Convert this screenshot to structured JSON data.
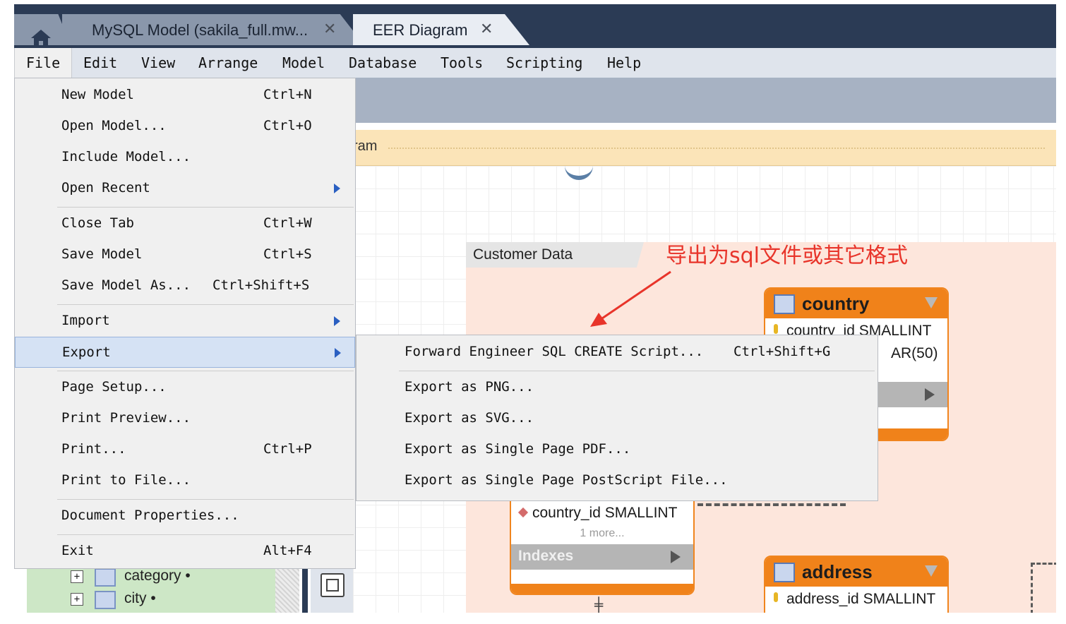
{
  "tabs": [
    {
      "label": "MySQL Model (sakila_full.mw...",
      "close": "✕"
    },
    {
      "label": "EER Diagram",
      "close": "✕"
    }
  ],
  "menubar": [
    "File",
    "Edit",
    "View",
    "Arrange",
    "Model",
    "Database",
    "Tools",
    "Scripting",
    "Help"
  ],
  "infobar": {
    "text": "ram"
  },
  "layer": {
    "label": "Customer Data"
  },
  "annotation": {
    "text": "导出为sql文件或其它格式",
    "color": "#e8342a"
  },
  "tables": {
    "country": {
      "title": "country",
      "col1": "country_id SMALLINT",
      "col2": "AR(50)"
    },
    "city_fk": {
      "col": "country_id SMALLINT",
      "more": "1 more...",
      "indexes": "Indexes"
    },
    "address": {
      "title": "address",
      "col1": "address_id SMALLINT"
    }
  },
  "tree": [
    {
      "label": "category •"
    },
    {
      "label": "city •"
    }
  ],
  "file_menu": [
    {
      "label": "New Model",
      "shortcut": "Ctrl+N"
    },
    {
      "label": "Open Model...",
      "shortcut": "Ctrl+O"
    },
    {
      "label": "Include Model...",
      "shortcut": ""
    },
    {
      "label": "Open Recent",
      "shortcut": "",
      "submenu": true
    },
    {
      "label": "Close Tab",
      "shortcut": "Ctrl+W"
    },
    {
      "label": "Save Model",
      "shortcut": "Ctrl+S"
    },
    {
      "label": "Save Model As...",
      "shortcut": "Ctrl+Shift+S"
    },
    {
      "label": "Import",
      "shortcut": "",
      "submenu": true
    },
    {
      "label": "Export",
      "shortcut": "",
      "submenu": true,
      "highlighted": true
    },
    {
      "label": "Page Setup...",
      "shortcut": ""
    },
    {
      "label": "Print Preview...",
      "shortcut": ""
    },
    {
      "label": "Print...",
      "shortcut": "Ctrl+P"
    },
    {
      "label": "Print to File...",
      "shortcut": ""
    },
    {
      "label": "Document Properties...",
      "shortcut": ""
    },
    {
      "label": "Exit",
      "shortcut": "Alt+F4"
    }
  ],
  "export_submenu": [
    {
      "label": "Forward Engineer SQL CREATE Script...",
      "shortcut": "Ctrl+Shift+G"
    },
    {
      "label": "Export as PNG...",
      "shortcut": ""
    },
    {
      "label": "Export as SVG...",
      "shortcut": ""
    },
    {
      "label": "Export as Single Page PDF...",
      "shortcut": ""
    },
    {
      "label": "Export as Single Page PostScript File...",
      "shortcut": ""
    }
  ],
  "colors": {
    "accent_orange": "#f0821a",
    "menu_highlight": "#d5e2f4",
    "tabbar": "#2b3b55"
  }
}
